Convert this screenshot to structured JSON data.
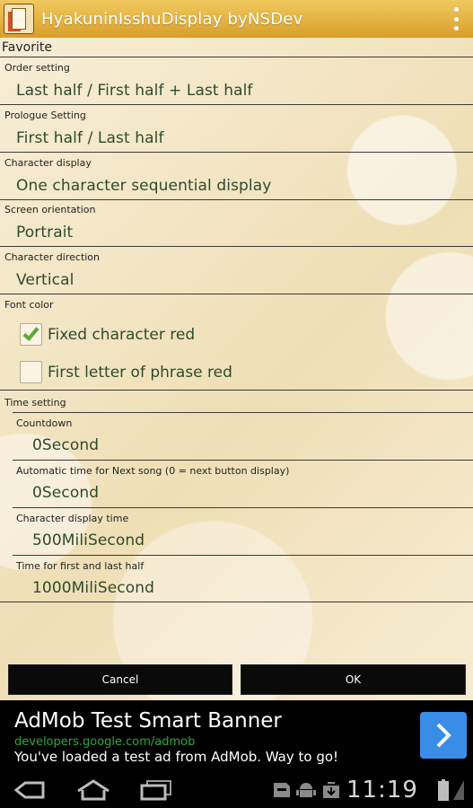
{
  "app": {
    "title": "HyakuninIsshuDisplay byNSDev"
  },
  "list_header": "Favorite",
  "settings": [
    {
      "label": "Order setting",
      "value": "Last half / First half + Last half"
    },
    {
      "label": "Prologue Setting",
      "value": "First half / Last half"
    },
    {
      "label": "Character display",
      "value": "One character sequential display"
    },
    {
      "label": "Screen orientation",
      "value": "Portrait"
    },
    {
      "label": "Character direction",
      "value": "Vertical"
    }
  ],
  "font_color": {
    "label": "Font color",
    "options": [
      {
        "label": "Fixed character red",
        "checked": true
      },
      {
        "label": "First letter of phrase red",
        "checked": false
      }
    ]
  },
  "time_setting": {
    "label": "Time setting",
    "items": [
      {
        "label": "Countdown",
        "value": "0Second"
      },
      {
        "label": "Automatic time for Next song (0 = next button display)",
        "value": "0Second"
      },
      {
        "label": "Character display time",
        "value": "500MiliSecond"
      },
      {
        "label": "Time for first and last half",
        "value": "1000MiliSecond"
      }
    ]
  },
  "buttons": {
    "cancel": "Cancel",
    "ok": "OK"
  },
  "ad": {
    "title": "AdMob Test Smart Banner",
    "url": "developers.google.com/admob",
    "line": "You've loaded a test ad from AdMob. Way to go!"
  },
  "status": {
    "clock": "11:19"
  },
  "colors": {
    "titlebar": "#e0aa36",
    "value_text": "#2f4a2e",
    "check_green": "#5aaa32",
    "ad_arrow": "#3a8de6",
    "ad_url": "#2aa836"
  },
  "icons": [
    "app-icon",
    "overflow-menu-icon",
    "checkmark-icon",
    "chevron-right-icon",
    "back-icon",
    "home-icon",
    "recent-apps-icon",
    "sd-card-icon",
    "android-debug-icon",
    "download-icon",
    "battery-icon"
  ]
}
